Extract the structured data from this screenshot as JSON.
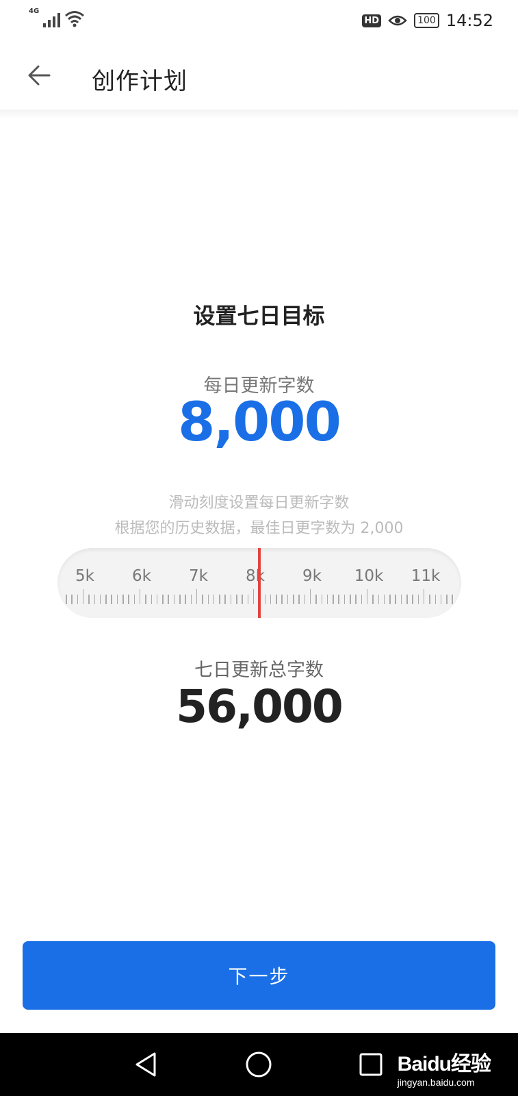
{
  "status_bar": {
    "network": "4G",
    "hd_badge": "HD",
    "battery": "100",
    "time": "14:52"
  },
  "header": {
    "title": "创作计划",
    "back_icon": "arrow-left-icon"
  },
  "goal": {
    "title": "设置七日目标",
    "daily_label": "每日更新字数",
    "daily_value": "8,000",
    "hint_line1": "滑动刻度设置每日更新字数",
    "hint_line2": "根据您的历史数据，最佳日更字数为 2,000",
    "ruler": {
      "labels": [
        "5k",
        "6k",
        "7k",
        "8k",
        "9k",
        "10k",
        "11k"
      ],
      "selected_value": 8000
    },
    "total_label": "七日更新总字数",
    "total_value": "56,000"
  },
  "actions": {
    "next_label": "下一步"
  },
  "navbar": {
    "back_icon": "triangle-back-icon",
    "home_icon": "circle-home-icon",
    "recent_icon": "square-recents-icon"
  },
  "watermark": {
    "logo": "Baidu经验",
    "url": "jingyan.baidu.com"
  },
  "colors": {
    "accent": "#1a6fe6",
    "indicator": "#e0443e"
  }
}
